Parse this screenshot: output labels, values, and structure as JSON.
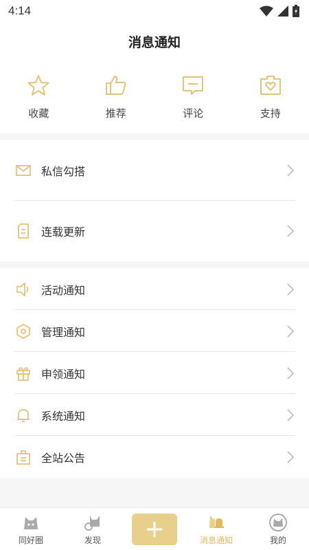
{
  "status": {
    "time": "4:14"
  },
  "header": {
    "title": "消息通知"
  },
  "quick": [
    {
      "label": "收藏",
      "icon": "star-icon"
    },
    {
      "label": "推荐",
      "icon": "thumbs-up-icon"
    },
    {
      "label": "评论",
      "icon": "comment-icon"
    },
    {
      "label": "支持",
      "icon": "gift-heart-icon"
    }
  ],
  "section1": [
    {
      "label": "私信勾搭",
      "icon": "mail-icon"
    },
    {
      "label": "连载更新",
      "icon": "document-icon"
    }
  ],
  "section2": [
    {
      "label": "活动通知",
      "icon": "speaker-icon"
    },
    {
      "label": "管理通知",
      "icon": "hexagon-icon"
    },
    {
      "label": "申领通知",
      "icon": "gift-icon"
    },
    {
      "label": "系统通知",
      "icon": "bell-icon"
    },
    {
      "label": "全站公告",
      "icon": "notice-board-icon"
    }
  ],
  "tabbar": [
    {
      "label": "同好圈",
      "icon": "cat-circle-icon",
      "active": false
    },
    {
      "label": "发现",
      "icon": "cat-ring-icon",
      "active": false
    },
    {
      "label": "消息通知",
      "icon": "cat-bell-icon",
      "active": true
    },
    {
      "label": "我的",
      "icon": "cat-avatar-icon",
      "active": false
    }
  ],
  "colors": {
    "accent": "#e0b860",
    "accent_light": "#e8cf8c",
    "icon": "#e3c27a"
  }
}
